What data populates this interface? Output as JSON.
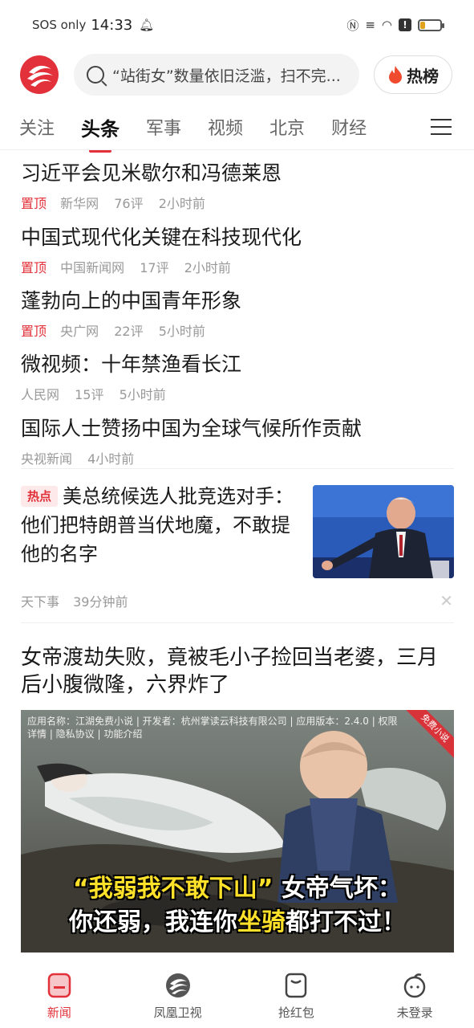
{
  "status_bar": {
    "carrier": "SOS only",
    "time": "14:33",
    "battery_level": 0.22
  },
  "header": {
    "search_placeholder": "“站街女”数量依旧泛滥，扫不完...",
    "hot_label": "热榜"
  },
  "tabs": [
    "关注",
    "头条",
    "军事",
    "视频",
    "北京",
    "财经"
  ],
  "active_tab": "头条",
  "top_news": [
    {
      "title": "习近平会见米歇尔和冯德莱恩",
      "pin": "置顶",
      "source": "新华网",
      "comments": "76评",
      "time": "2小时前"
    },
    {
      "title": "中国式现代化关键在科技现代化",
      "pin": "置顶",
      "source": "中国新闻网",
      "comments": "17评",
      "time": "2小时前"
    },
    {
      "title": "蓬勃向上的中国青年形象",
      "pin": "置顶",
      "source": "央广网",
      "comments": "22评",
      "time": "5小时前"
    },
    {
      "title": "微视频：十年禁渔看长江",
      "pin": "",
      "source": "人民网",
      "comments": "15评",
      "time": "5小时前"
    },
    {
      "title": "国际人士赞扬中国为全球气候所作贡献",
      "pin": "",
      "source": "央视新闻",
      "comments": "",
      "time": "4小时前"
    }
  ],
  "hot_news": {
    "badge": "热点",
    "title": "美总统候选人批竞选对手：他们把特朗普当伏地魔，不敢提他的名字",
    "source": "天下事",
    "time": "39分钟前"
  },
  "ad": {
    "title": "女帝渡劫失败，竟被毛小子捡回当老婆，三月后小腹微隆，六界炸了",
    "info": "应用名称：江湖免费小说 | 开发者：杭州掌读云科技有限公司 | 应用版本：2.4.0 | 权限详情 | 隐私协议 | 功能介绍",
    "corner": "免费小说",
    "caption_line1_a": "“我弱我不敢下山”",
    "caption_line1_b": "女帝气坏：",
    "caption_line2_a": "你还弱，我连你",
    "caption_line2_b": "坐骑",
    "caption_line2_c": "都打不过！"
  },
  "bottom_nav": {
    "news": "新闻",
    "tv": "凤凰卫视",
    "redpacket": "抢红包",
    "profile": "未登录"
  },
  "colors": {
    "accent": "#e2313a",
    "meta": "#999999"
  }
}
